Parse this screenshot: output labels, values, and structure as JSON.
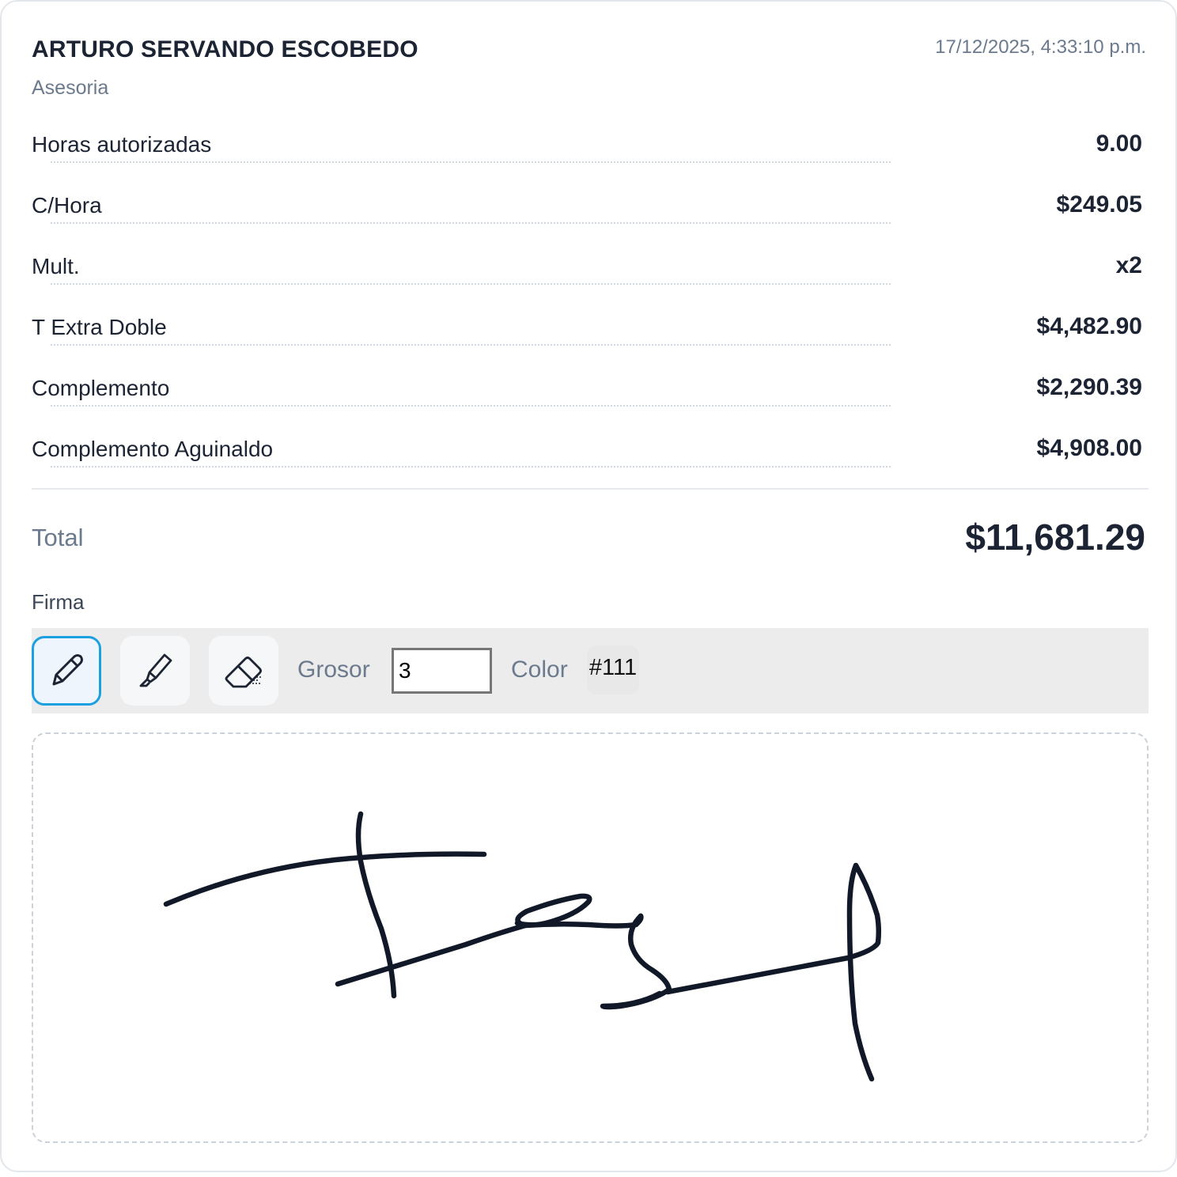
{
  "employee": {
    "name": "ARTURO SERVANDO ESCOBEDO",
    "department": "Asesoria",
    "timestamp": "17/12/2025, 4:33:10 p.m."
  },
  "rows": [
    {
      "label": "Horas autorizadas",
      "value": "9.00"
    },
    {
      "label": "C/Hora",
      "value": "$249.05"
    },
    {
      "label": "Mult.",
      "value": "x2"
    },
    {
      "label": "T Extra Doble",
      "value": "$4,482.90"
    },
    {
      "label": "Complemento",
      "value": "$2,290.39"
    },
    {
      "label": "Complemento Aguinaldo",
      "value": "$4,908.00"
    }
  ],
  "total": {
    "label": "Total",
    "value": "$11,681.29"
  },
  "signature": {
    "label": "Firma",
    "tools": [
      {
        "name": "pen-icon",
        "active": true
      },
      {
        "name": "highlighter-icon",
        "active": false
      },
      {
        "name": "eraser-icon",
        "active": false
      }
    ],
    "grosor_label": "Grosor",
    "grosor_value": "3",
    "color_label": "Color",
    "color_value": "#111",
    "accent_color": "#1da0e0"
  }
}
